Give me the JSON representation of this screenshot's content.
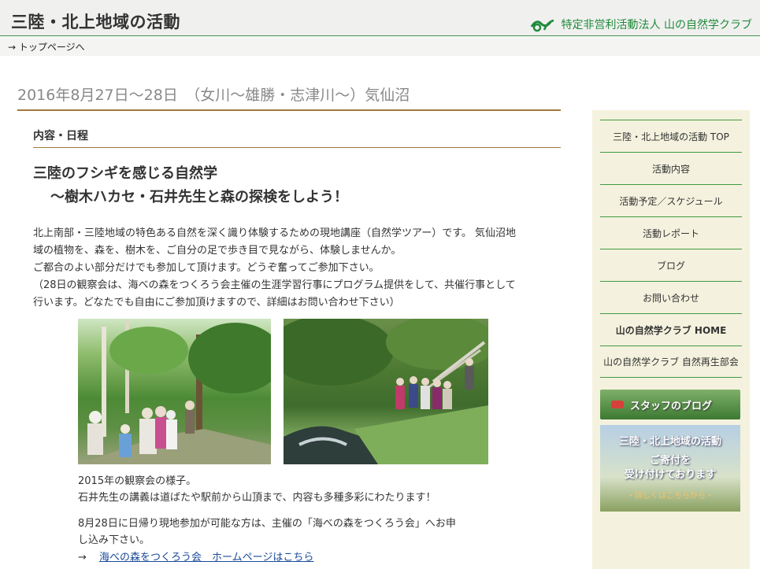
{
  "header": {
    "site_title": "三陸・北上地域の活動",
    "org_name": "特定非営利活動法人 山の自然学クラブ",
    "top_link": "→ トップページへ"
  },
  "main": {
    "page_heading": "2016年8月27日～28日　（女川～雄勝・志津川～）気仙沼",
    "section_label": "内容・日程",
    "title_line1": "三陸のフシギを感じる自然学",
    "title_line2": "～樹木ハカセ・石井先生と森の探検をしよう！",
    "intro": [
      "北上南部・三陸地域の特色ある自然を深く識り体験するための現地講座（自然学ツアー）です。 気仙沼地",
      "域の植物を、森を、樹木を、ご自分の足で歩き目で見ながら、体験しませんか。",
      "ご都合のよい部分だけでも参加して頂けます。どうぞ奮ってご参加下さい。",
      "（28日の観察会は、海べの森をつくろう会主催の生涯学習行事にプログラム提供をして、共催行事として",
      "行います。どなたでも自由にご参加頂けますので、詳細はお問い合わせ下さい）"
    ],
    "caption": [
      "2015年の観察会の様子。",
      "石井先生の講義は道ばたや駅前から山頂まで、内容も多種多彩にわたります！"
    ],
    "note": [
      "8月28日に日帰り現地参加が可能な方は、主催の「海べの森をつくろう会」へお申",
      "し込み下さい。"
    ],
    "link_prefix": "→",
    "link_text": "海べの森をつくろう会　ホームページはこちら"
  },
  "sidebar": {
    "items": [
      {
        "label": "三陸・北上地域の活動 TOP"
      },
      {
        "label": "活動内容"
      },
      {
        "label": "活動予定／スケジュール"
      },
      {
        "label": "活動レポート"
      },
      {
        "label": "ブログ"
      },
      {
        "label": "お問い合わせ"
      },
      {
        "label": "山の自然学クラブ HOME"
      },
      {
        "label": "山の自然学クラブ 自然再生部会"
      }
    ],
    "blog_banner": "スタッフのブログ",
    "donate_title": "三陸・北上地域の活動",
    "donate_line1": "ご寄付を",
    "donate_line2": "受け付けております",
    "donate_more": "・詳しくはこちらから・"
  },
  "colors": {
    "accent_green": "#1f8a3a",
    "divider_brown": "#a07a3a",
    "sidebar_bg": "#f4f2de"
  }
}
